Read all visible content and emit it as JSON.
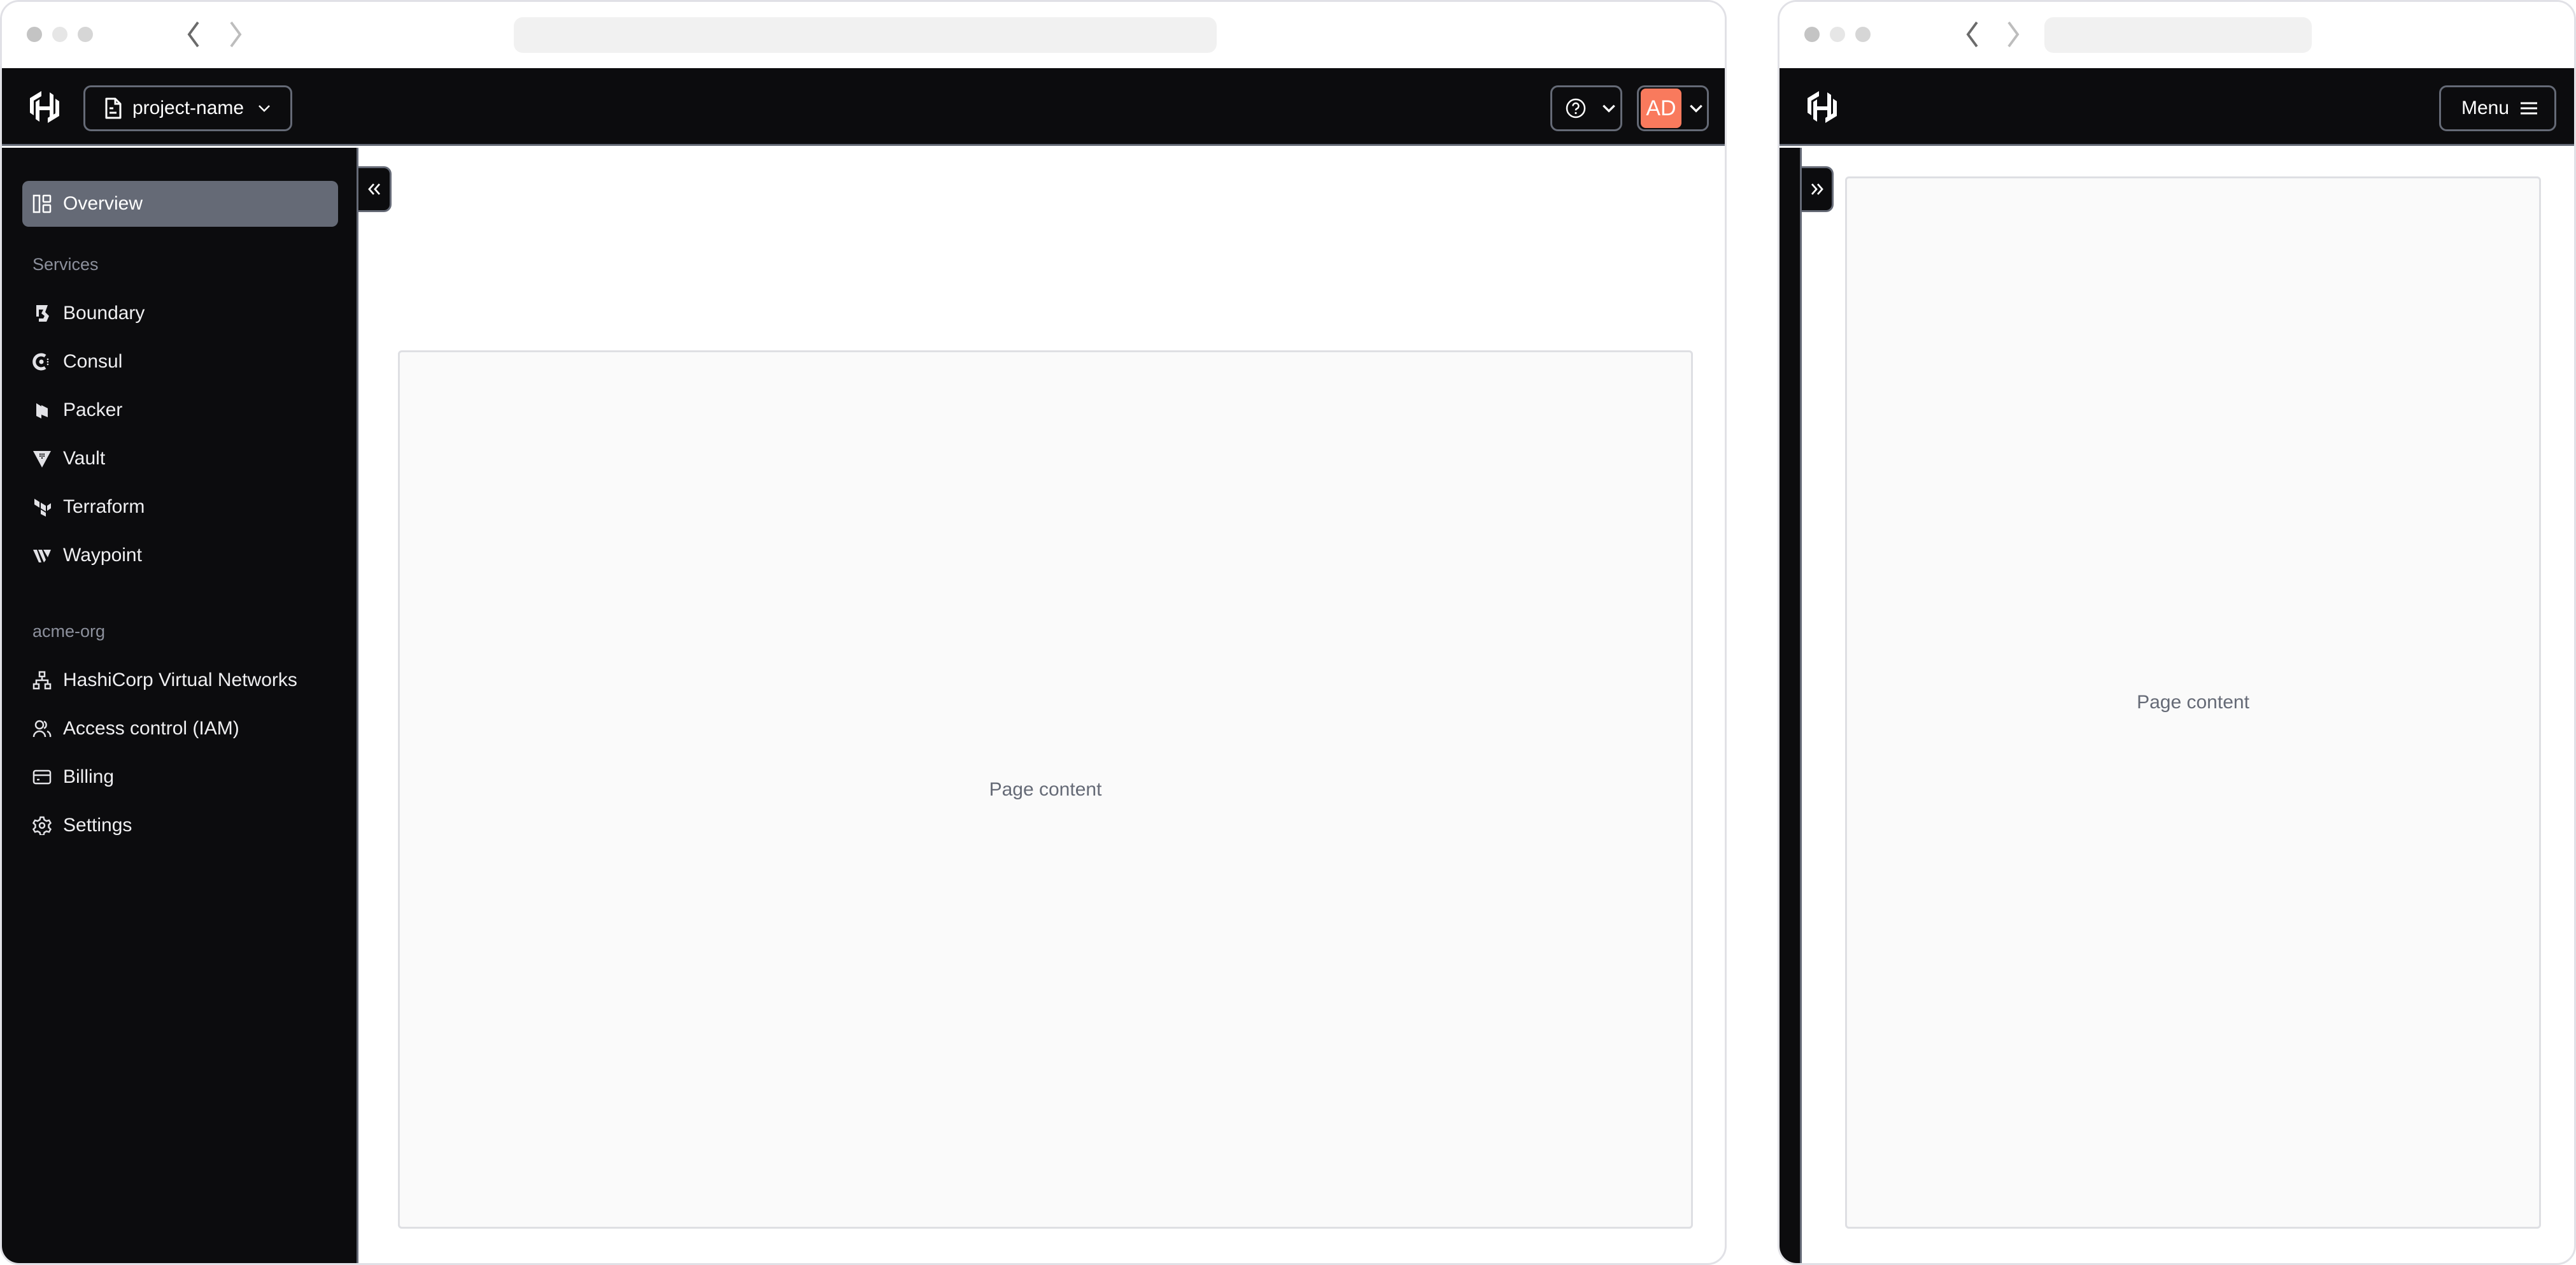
{
  "desktop": {
    "chrome": {
      "back_icon": "chevron-left",
      "forward_icon": "chevron-right",
      "url": ""
    },
    "header": {
      "logo": "hashicorp-logo",
      "project_selector": {
        "icon": "file-text-icon",
        "label": "project-name"
      },
      "help_button": {
        "icon": "help-circle-icon"
      },
      "user_menu": {
        "avatar_initials": "AD",
        "avatar_color": "#f97a5d"
      }
    },
    "sidebar": {
      "overview": {
        "label": "Overview",
        "icon": "dashboard-icon",
        "active": true
      },
      "sections": [
        {
          "title": "Services",
          "items": [
            {
              "label": "Boundary",
              "icon": "boundary-icon"
            },
            {
              "label": "Consul",
              "icon": "consul-icon"
            },
            {
              "label": "Packer",
              "icon": "packer-icon"
            },
            {
              "label": "Vault",
              "icon": "vault-icon"
            },
            {
              "label": "Terraform",
              "icon": "terraform-icon"
            },
            {
              "label": "Waypoint",
              "icon": "waypoint-icon"
            }
          ]
        },
        {
          "title": "acme-org",
          "items": [
            {
              "label": "HashiCorp Virtual Networks",
              "icon": "network-icon"
            },
            {
              "label": "Access control (IAM)",
              "icon": "users-icon"
            },
            {
              "label": "Billing",
              "icon": "credit-card-icon"
            },
            {
              "label": "Settings",
              "icon": "gear-icon"
            }
          ]
        }
      ],
      "toggle": {
        "icon": "chevrons-left-icon",
        "state": "expanded"
      }
    },
    "main": {
      "placeholder": "Page content"
    }
  },
  "mobile": {
    "chrome": {
      "back_icon": "chevron-left",
      "forward_icon": "chevron-right",
      "url": ""
    },
    "header": {
      "logo": "hashicorp-logo",
      "menu_button": {
        "label": "Menu",
        "icon": "hamburger-icon"
      }
    },
    "sidebar": {
      "toggle": {
        "icon": "chevrons-right-icon",
        "state": "collapsed"
      }
    },
    "main": {
      "placeholder": "Page content"
    }
  },
  "colors": {
    "header_bg": "#0c0c0e",
    "border": "#656a76",
    "active_item": "#656a76",
    "avatar": "#f97a5d",
    "content_bg": "#fafafa"
  }
}
